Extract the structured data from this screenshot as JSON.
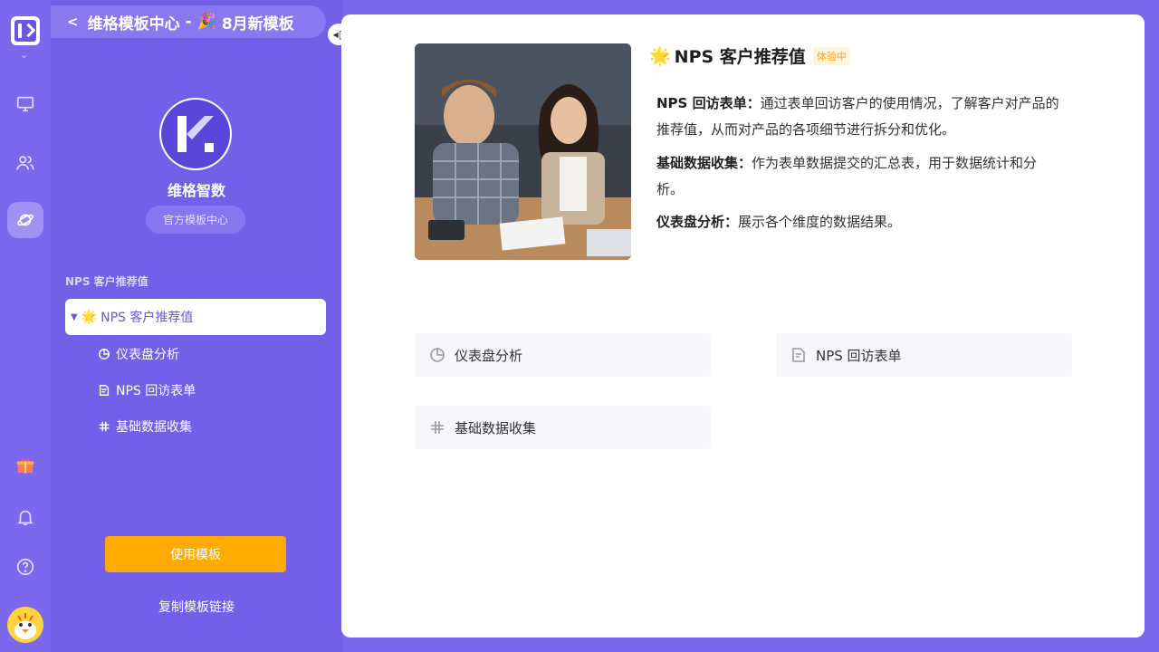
{
  "colors": {
    "accent": "#7b68ee",
    "button": "#ffaa00",
    "badge": "#f5a623"
  },
  "rail": {
    "icons": [
      "monitor-icon",
      "users-icon",
      "planet-icon",
      "gift-icon",
      "bell-icon",
      "help-icon"
    ]
  },
  "breadcrumb": {
    "title": "维格模板中心",
    "separator": "-",
    "subtitle": "8月新模板"
  },
  "brand": {
    "name": "维格智数",
    "tag": "官方模板中心"
  },
  "nav": {
    "section_title": "NPS 客户推荐值",
    "root": "NPS 客户推荐值",
    "items": [
      {
        "label": "仪表盘分析",
        "icon": "pie-chart-icon"
      },
      {
        "label": "NPS 回访表单",
        "icon": "form-icon"
      },
      {
        "label": "基础数据收集",
        "icon": "grid-icon"
      }
    ]
  },
  "actions": {
    "use_template": "使用模板",
    "copy_link": "复制模板链接"
  },
  "main": {
    "title": "NPS 客户推荐值",
    "badge": "体验中",
    "desc": [
      {
        "label": "NPS 回访表单：",
        "text": "通过表单回访客户的使用情况，了解客户对产品的推荐值，从而对产品的各项细节进行拆分和优化。"
      },
      {
        "label": "基础数据收集：",
        "text": "作为表单数据提交的汇总表，用于数据统计和分析。"
      },
      {
        "label": "仪表盘分析：",
        "text": "展示各个维度的数据结果。"
      }
    ],
    "tiles": [
      {
        "label": "仪表盘分析",
        "icon": "pie-chart-icon"
      },
      {
        "label": "NPS 回访表单",
        "icon": "form-icon"
      },
      {
        "label": "基础数据收集",
        "icon": "grid-icon"
      }
    ]
  }
}
